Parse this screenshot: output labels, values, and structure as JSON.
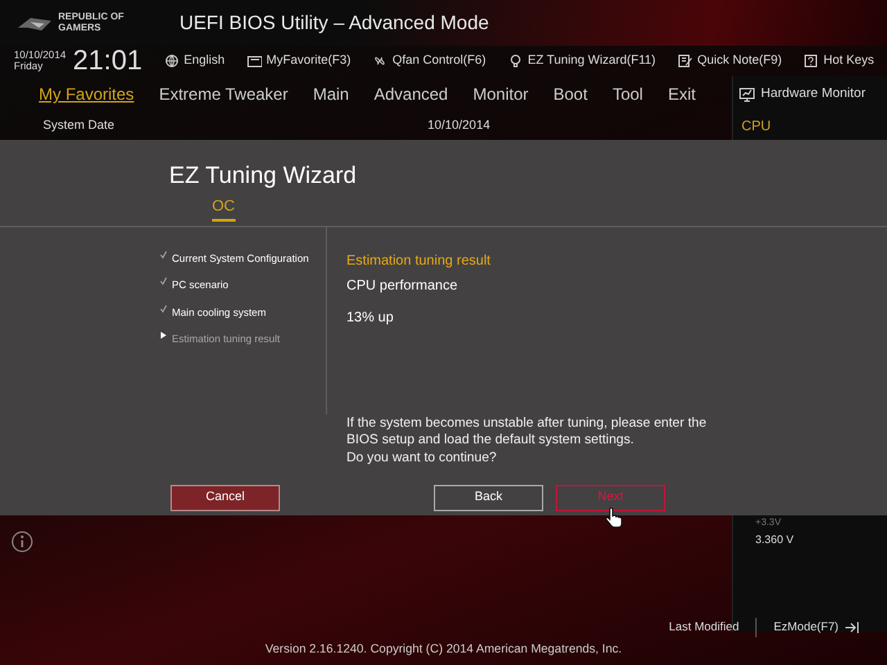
{
  "header": {
    "logo_lines": [
      "REPUBLIC OF",
      "GAMERS"
    ],
    "title": "UEFI BIOS Utility – Advanced Mode"
  },
  "clock": {
    "date": "10/10/2014",
    "day": "Friday",
    "time": "21:01"
  },
  "toolbar": [
    {
      "kind": "globe",
      "label": "English"
    },
    {
      "kind": "favorite",
      "label": "MyFavorite(F3)"
    },
    {
      "kind": "fan",
      "label": "Qfan Control(F6)"
    },
    {
      "kind": "bulb",
      "label": "EZ Tuning Wizard(F11)"
    },
    {
      "kind": "note",
      "label": "Quick Note(F9)"
    },
    {
      "kind": "help",
      "label": "Hot Keys"
    }
  ],
  "tabs": [
    {
      "label": "My Favorites",
      "selected": true
    },
    {
      "label": "Extreme Tweaker",
      "selected": false
    },
    {
      "label": "Main",
      "selected": false
    },
    {
      "label": "Advanced",
      "selected": false
    },
    {
      "label": "Monitor",
      "selected": false
    },
    {
      "label": "Boot",
      "selected": false
    },
    {
      "label": "Tool",
      "selected": false
    },
    {
      "label": "Exit",
      "selected": false
    }
  ],
  "content": {
    "item": "System Date",
    "value": "10/10/2014"
  },
  "hardware_monitor": {
    "title": "Hardware Monitor",
    "section": "CPU",
    "readings": [
      {
        "label": "+3.3V",
        "value": "3.360 V"
      }
    ]
  },
  "wizard": {
    "title": "EZ Tuning Wizard",
    "tabs": [
      {
        "label": "OC",
        "selected": true
      }
    ],
    "steps": [
      {
        "label": "Current System Configuration",
        "checked": true,
        "selected": false
      },
      {
        "label": "PC scenario",
        "checked": true,
        "selected": false
      },
      {
        "label": "Main cooling system",
        "checked": true,
        "selected": false
      },
      {
        "label": "Estimation tuning result",
        "checked": false,
        "selected": true
      }
    ],
    "result_heading": "Estimation tuning result",
    "result_lines": [
      "CPU performance",
      "13% up"
    ],
    "message_lines": [
      "If the system becomes unstable after tuning, please enter the",
      "BIOS setup and load the default system settings.",
      "Do you want to continue?"
    ],
    "buttons": [
      {
        "kind": "cancel",
        "label": "Cancel",
        "selected": false
      },
      {
        "kind": "back",
        "label": "Back",
        "selected": false
      },
      {
        "kind": "next",
        "label": "Next",
        "selected": true
      }
    ]
  },
  "footer": {
    "last_modified": "Last Modified",
    "ez_mode": "EzMode(F7)",
    "version": "Version 2.16.1240. Copyright (C) 2014 American Megatrends, Inc."
  }
}
